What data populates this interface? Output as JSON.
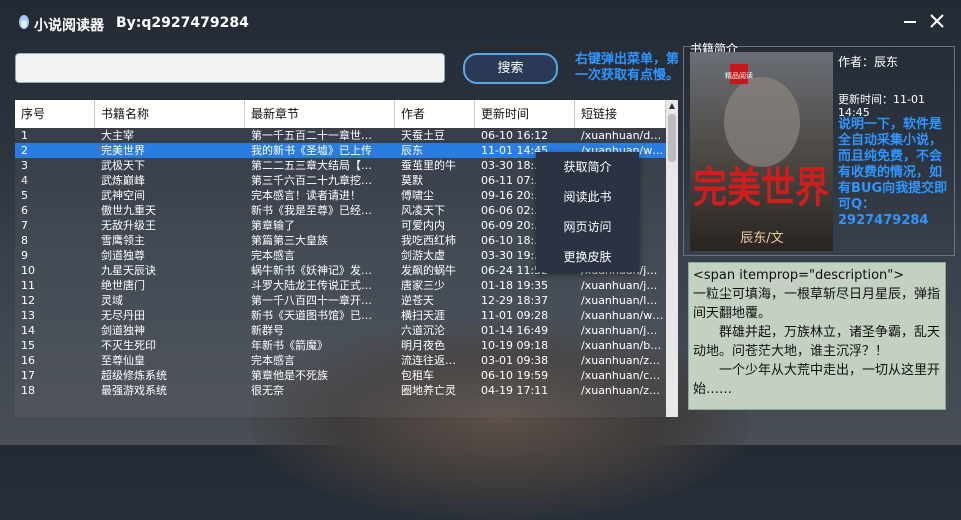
{
  "app": {
    "title": "小说阅读器",
    "by": "By:q2927479284"
  },
  "search": {
    "value": "",
    "placeholder": "",
    "button": "搜索"
  },
  "hint": "右键弹出菜单，第一次获取有点慢。",
  "table": {
    "columns": [
      "序号",
      "书籍名称",
      "最新章节",
      "作者",
      "更新时间",
      "短链接"
    ],
    "selected_index": 1,
    "rows": [
      [
        "1",
        "大主宰",
        "第一千五百二十一章世…",
        "天蚕土豆",
        "06-10 16:12",
        "/xuanhuan/d…"
      ],
      [
        "2",
        "完美世界",
        "我的新书《圣墟》已上传",
        "辰东",
        "11-01 14:45",
        "/xuanhuan/w…"
      ],
      [
        "3",
        "武极天下",
        "第二二五三章大结局【…",
        "蚕茧里的牛",
        "03-30 18:…",
        ""
      ],
      [
        "4",
        "武炼巅峰",
        "第三千六百二十九章挖…",
        "莫默",
        "06-11 07:…",
        ""
      ],
      [
        "5",
        "武神空间",
        "完本感言！读者请进！",
        "傅啸尘",
        "09-16 20:…",
        ""
      ],
      [
        "6",
        "傲世九重天",
        "新书《我是至尊》已经…",
        "风凌天下",
        "06-06 02:…",
        ""
      ],
      [
        "7",
        "无敌升级王",
        "第章输了",
        "可爱内内",
        "06-09 20:…",
        ""
      ],
      [
        "8",
        "雪鹰领主",
        "第篇第三大皇族",
        "我吃西红柿",
        "06-10 18:…",
        ""
      ],
      [
        "9",
        "剑道独尊",
        "完本感言",
        "剑游太虚",
        "03-30 19:…",
        ""
      ],
      [
        "10",
        "九星天辰诀",
        "蜗牛新书《妖神记》发…",
        "发飙的蜗牛",
        "06-24 11:52",
        "/xuanhuan/j…"
      ],
      [
        "11",
        "绝世唐门",
        "斗罗大陆龙王传说正式…",
        "唐家三少",
        "01-18 19:35",
        "/xuanhuan/j…"
      ],
      [
        "12",
        "灵域",
        "第一千八百四十一章开…",
        "逆苍天",
        "12-29 18:37",
        "/xuanhuan/l…"
      ],
      [
        "13",
        "无尽丹田",
        "新书《天道图书馆》已…",
        "横扫天涯",
        "11-01 09:28",
        "/xuanhuan/w…"
      ],
      [
        "14",
        "剑道独神",
        "新群号",
        "六道沉沦",
        "01-14 16:49",
        "/xuanhuan/j…"
      ],
      [
        "15",
        "不灭生死印",
        "年新书《箭魔》",
        "明月夜色",
        "10-19 09:18",
        "/xuanhuan/b…"
      ],
      [
        "16",
        "至尊仙皇",
        "完本感言",
        "流连往返…",
        "03-01 09:38",
        "/xuanhuan/z…"
      ],
      [
        "17",
        "超级修炼系统",
        "第章他是不死族",
        "包租车",
        "06-10 19:59",
        "/xuanhuan/c…"
      ],
      [
        "18",
        "最强游戏系统",
        "很无奈",
        "圈地养亡灵",
        "04-19 17:11",
        "/xuanhuan/z…"
      ]
    ]
  },
  "context_menu": {
    "items": [
      "获取简介",
      "阅读此书",
      "网页访问",
      "更换皮肤"
    ]
  },
  "info": {
    "panel_title": "书籍简介",
    "cover_title": "完美世界",
    "cover_author": "辰东/文",
    "cover_tag": "精品阅读",
    "author": "作者：辰东",
    "update_time": "更新时间：11-01 14:45",
    "note": "说明一下，软件是全自动采集小说，而且纯免费，不会有收费的情况，如有BUG向我提交即可Q：2927479284",
    "description": [
      "<span itemprop=\"description\">",
      "一粒尘可填海，一根草斩尽日月星辰，弹指间天翻地覆。",
      "　　群雄并起，万族林立，诸圣争霸，乱天动地。问苍茫大地，谁主沉浮？！",
      "　　一个少年从大荒中走出，一切从这里开始……"
    ]
  },
  "colors": {
    "accent": "#2f95ff",
    "selected_row": "#2a7ce0",
    "menu_bg": "#2b3342"
  }
}
